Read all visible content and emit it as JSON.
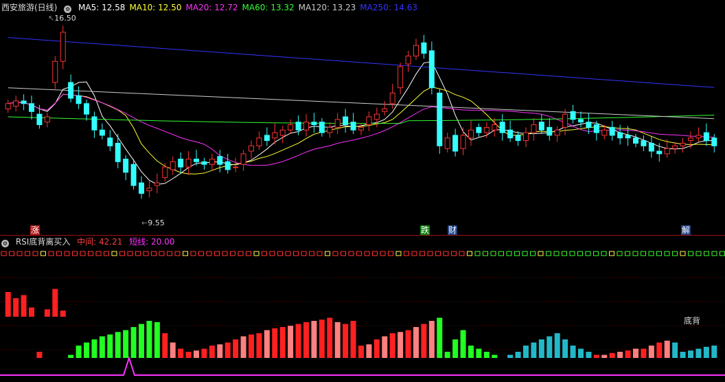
{
  "main": {
    "title": "西安旅游(日线)",
    "ma": [
      {
        "label": "MA5: 12.58",
        "color": "#ffffff"
      },
      {
        "label": "MA10: 12.50",
        "color": "#ffff33"
      },
      {
        "label": "MA20: 12.72",
        "color": "#ff33ff"
      },
      {
        "label": "MA60: 13.32",
        "color": "#33ff33"
      },
      {
        "label": "MA120: 13.23",
        "color": "#cccccc"
      },
      {
        "label": "MA250: 14.63",
        "color": "#3333ff"
      }
    ],
    "high_label": "16.50",
    "low_label": "9.55",
    "markers": [
      {
        "text": "涨",
        "color": "#ffffff",
        "bg": "#c02020"
      },
      {
        "text": "跌",
        "color": "#ffffff",
        "bg": "#20a020"
      },
      {
        "text": "财",
        "color": "#ffffff",
        "bg": "#2060c0"
      },
      {
        "text": "解",
        "color": "#ffffff",
        "bg": "#2060c0"
      }
    ]
  },
  "indicator": {
    "title": "RSI底背离买入",
    "mid_label": "中间: 42.21",
    "short_label": "短线: 20.00",
    "signal_text": "底背"
  },
  "colors": {
    "up": "#ff3333",
    "down": "#33ffff",
    "bg": "#000000",
    "grid": "#5a0a0a",
    "bar_red": "#ff2020",
    "bar_pink": "#ff8080",
    "bar_green": "#22ff22",
    "bar_cyan": "#22b8c8",
    "signal": "#ff33ff"
  },
  "chart_data": [
    {
      "type": "candlestick",
      "title": "西安旅游(日线)",
      "series": [
        {
          "name": "MA5",
          "last": 12.58
        },
        {
          "name": "MA10",
          "last": 12.5
        },
        {
          "name": "MA20",
          "last": 12.72
        },
        {
          "name": "MA60",
          "last": 13.32
        },
        {
          "name": "MA120",
          "last": 13.23
        },
        {
          "name": "MA250",
          "last": 14.63
        }
      ],
      "annotations": {
        "high": 16.5,
        "low": 9.55
      },
      "close": [
        13.6,
        13.7,
        13.6,
        13.3,
        12.8,
        13.1,
        15.2,
        16.3,
        13.8,
        13.6,
        13.2,
        12.6,
        12.4,
        12.0,
        11.4,
        11.0,
        10.5,
        10.2,
        10.4,
        10.6,
        11.2,
        11.4,
        11.2,
        11.5,
        11.4,
        11.3,
        11.5,
        11.3,
        11.1,
        11.2,
        11.7,
        12.0,
        12.3,
        12.2,
        12.5,
        12.6,
        12.8,
        12.6,
        12.9,
        12.8,
        12.5,
        12.7,
        13.0,
        12.8,
        12.6,
        12.7,
        13.1,
        13.2,
        13.4,
        14.0,
        15.0,
        15.4,
        15.8,
        15.5,
        14.2,
        12.0,
        12.3,
        11.8,
        12.4,
        12.6,
        12.5,
        12.7,
        12.8,
        12.5,
        12.3,
        12.2,
        12.5,
        12.8,
        12.6,
        12.4,
        12.6,
        13.2,
        13.0,
        12.9,
        12.7,
        12.5,
        12.6,
        12.4,
        12.3,
        12.3,
        12.1,
        12.0,
        11.8,
        11.7,
        11.9,
        12.0,
        12.1,
        12.3,
        12.4,
        12.2,
        12.0
      ],
      "open": [
        13.4,
        13.5,
        13.7,
        13.6,
        13.2,
        12.9,
        14.4,
        15.2,
        14.4,
        13.9,
        13.6,
        13.1,
        12.6,
        12.3,
        12.1,
        11.5,
        11.3,
        10.6,
        10.3,
        10.5,
        10.8,
        11.1,
        11.5,
        11.2,
        11.5,
        11.4,
        11.3,
        11.6,
        11.4,
        11.2,
        11.3,
        11.8,
        12.0,
        12.4,
        12.3,
        12.4,
        12.6,
        12.9,
        12.6,
        12.9,
        12.9,
        12.5,
        12.7,
        13.1,
        12.9,
        12.6,
        12.8,
        13.0,
        13.3,
        13.6,
        14.2,
        15.1,
        15.4,
        15.9,
        15.6,
        14.0,
        11.9,
        12.4,
        11.9,
        12.3,
        12.7,
        12.5,
        12.6,
        12.9,
        12.6,
        12.4,
        12.2,
        12.5,
        12.9,
        12.7,
        12.4,
        12.7,
        13.3,
        13.0,
        12.9,
        12.8,
        12.4,
        12.7,
        12.5,
        12.4,
        12.3,
        12.2,
        12.1,
        11.8,
        11.7,
        11.9,
        12.0,
        12.2,
        12.3,
        12.5,
        12.3
      ]
    },
    {
      "type": "bar",
      "title": "RSI底背离买入",
      "series": [
        {
          "name": "中间",
          "last": 42.21
        },
        {
          "name": "短线",
          "last": 20.0
        }
      ]
    }
  ]
}
